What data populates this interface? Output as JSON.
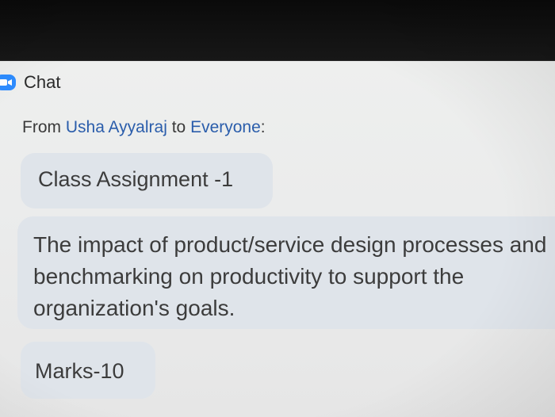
{
  "header": {
    "title": "Chat",
    "icon": "video-camera-icon",
    "icon_color": "#2d8cff"
  },
  "chat": {
    "from_prefix": "From",
    "sender": "Usha Ayyalraj",
    "to_word": "to",
    "recipient": "Everyone",
    "recipient_suffix": ":",
    "name_color": "#2a5dab",
    "bubble_color": "#dfe4ea",
    "messages": [
      {
        "text": "Class Assignment -1"
      },
      {
        "text": "The impact of product/service design processes and benchmarking on productivity to support the organization's goals."
      },
      {
        "text": "Marks-10"
      }
    ]
  }
}
